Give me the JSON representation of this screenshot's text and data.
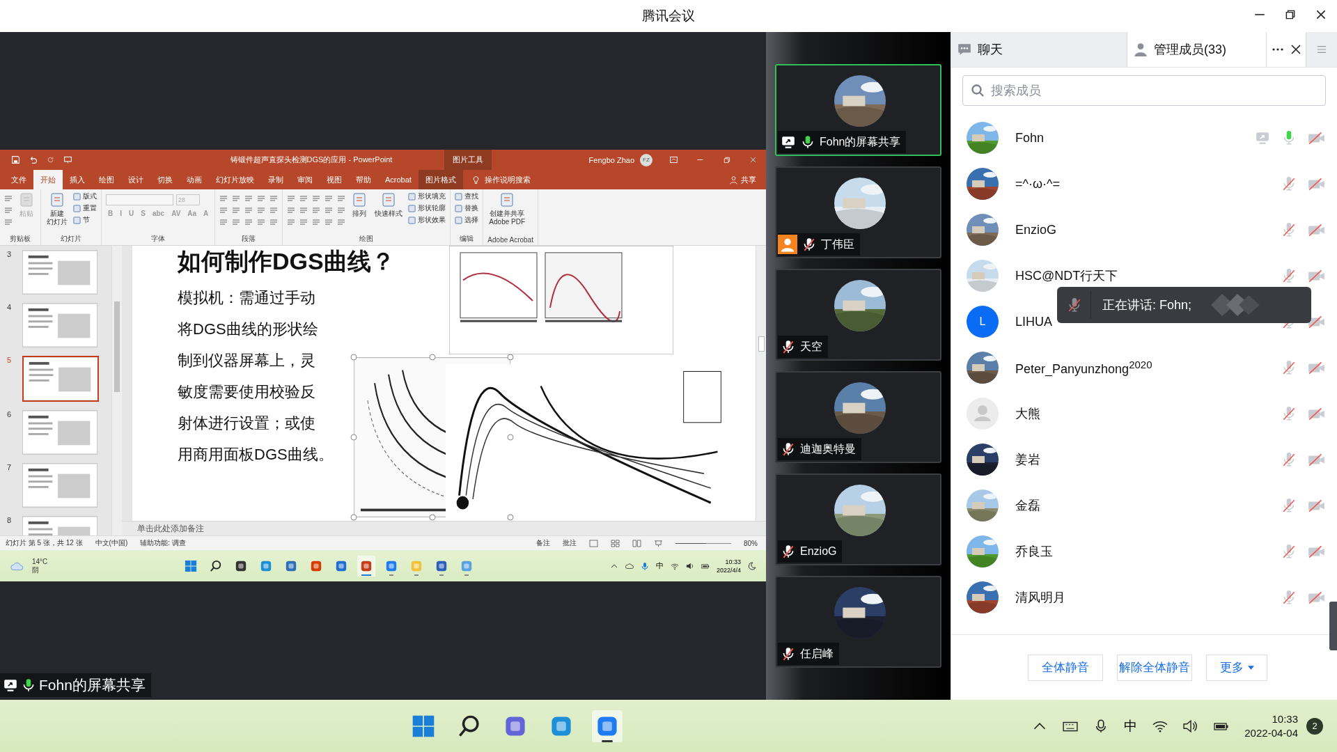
{
  "window": {
    "title": "腾讯会议"
  },
  "share_caption": {
    "text": "Fohn的屏幕共享",
    "mic_on": true
  },
  "ppt": {
    "title": "铸锻件超声直探头检测DGS的应用  -  PowerPoint",
    "context_label": "图片工具",
    "user": "Fengbo Zhao",
    "initials": "FZ",
    "tabs": [
      {
        "label": "文件",
        "selected": false
      },
      {
        "label": "开始",
        "selected": true
      },
      {
        "label": "插入",
        "selected": false
      },
      {
        "label": "绘图",
        "selected": false
      },
      {
        "label": "设计",
        "selected": false
      },
      {
        "label": "切换",
        "selected": false
      },
      {
        "label": "动画",
        "selected": false
      },
      {
        "label": "幻灯片放映",
        "selected": false
      },
      {
        "label": "录制",
        "selected": false
      },
      {
        "label": "审阅",
        "selected": false
      },
      {
        "label": "视图",
        "selected": false
      },
      {
        "label": "帮助",
        "selected": false
      },
      {
        "label": "Acrobat",
        "selected": false
      },
      {
        "label": "图片格式",
        "selected": false,
        "kind": "context"
      }
    ],
    "tell_me": "操作说明搜索",
    "share": "共享",
    "groups": [
      {
        "label": "剪贴板",
        "items": [
          {
            "kind": "large",
            "lines": [
              "粘贴"
            ],
            "disabled": true
          }
        ]
      },
      {
        "label": "幻灯片",
        "items": [
          {
            "kind": "large",
            "lines": [
              "新建",
              "幻灯片"
            ],
            "disabled": false
          },
          {
            "kind": "stack",
            "labels": [
              "版式",
              "重置",
              "节"
            ]
          }
        ]
      },
      {
        "label": "字体",
        "items": [
          {
            "kind": "font",
            "size": "28",
            "glyphs": [
              "B",
              "I",
              "U",
              "S",
              "abc",
              "AV",
              "Aa",
              "A"
            ]
          }
        ]
      },
      {
        "label": "段落"
      },
      {
        "label": "绘图",
        "items": [
          {
            "kind": "large",
            "lines": [
              "排列"
            ],
            "disabled": false
          },
          {
            "kind": "large",
            "lines": [
              "快速样式"
            ],
            "disabled": false
          },
          {
            "kind": "stack",
            "labels": [
              "形状填充",
              "形状轮廓",
              "形状效果"
            ]
          }
        ]
      },
      {
        "label": "编辑",
        "items": [
          {
            "kind": "stack",
            "labels": [
              "查找",
              "替换",
              "选择"
            ]
          }
        ]
      },
      {
        "label": "Adobe Acrobat",
        "items": [
          {
            "kind": "large",
            "lines": [
              "创建并共享",
              "Adobe PDF"
            ],
            "disabled": false
          }
        ]
      }
    ],
    "slides": [
      {
        "number": "3",
        "selected": false
      },
      {
        "number": "4",
        "selected": false
      },
      {
        "number": "5",
        "selected": true
      },
      {
        "number": "6",
        "selected": false
      },
      {
        "number": "7",
        "selected": false
      },
      {
        "number": "8",
        "selected": false
      }
    ],
    "slide": {
      "title": "如何制作DGS曲线？",
      "body_lines": [
        "模拟机：需通过手动",
        "将DGS曲线的形状绘",
        "制到仪器屏幕上，灵",
        "敏度需要使用校验反",
        "射体进行设置；或使",
        "用商用面板DGS曲线。"
      ]
    },
    "notes_placeholder": "单击此处添加备注",
    "status": {
      "slide_info": "幻灯片 第 5 张，共 12 张",
      "language": "中文(中国)",
      "accessibility": "辅助功能: 调查",
      "notes": "备注",
      "comments": "批注",
      "zoom": {
        "level": 0.55
      },
      "zoom_text": "80%"
    },
    "taskbar": {
      "temperature": "14°C",
      "weather": "阴",
      "ime": "中",
      "time": "10:33",
      "date": "2022/4/4",
      "apps": [
        {
          "kind": "start",
          "running": false,
          "selected": false
        },
        {
          "kind": "search",
          "running": false,
          "selected": false
        },
        {
          "kind": "taskview",
          "running": false,
          "selected": false
        },
        {
          "kind": "edge",
          "running": false,
          "selected": false
        },
        {
          "kind": "store",
          "running": false,
          "selected": false
        },
        {
          "kind": "office",
          "running": false,
          "selected": false
        },
        {
          "kind": "tiles",
          "running": false,
          "selected": false
        },
        {
          "kind": "slides",
          "running": true,
          "selected": true
        },
        {
          "kind": "meeting",
          "running": true,
          "selected": false
        },
        {
          "kind": "folder",
          "running": true,
          "selected": false
        },
        {
          "kind": "doc",
          "running": true,
          "selected": false
        },
        {
          "kind": "paint",
          "running": true,
          "selected": false
        }
      ]
    }
  },
  "video_tiles": [
    {
      "name": "Fohn的屏幕共享",
      "sharing": true,
      "host": false,
      "mic_on": true,
      "selected": true
    },
    {
      "name": "丁伟臣",
      "sharing": false,
      "host": true,
      "mic_on": false,
      "selected": false
    },
    {
      "name": "天空",
      "sharing": false,
      "host": false,
      "mic_on": false,
      "selected": false
    },
    {
      "name": "迪迦奥特曼",
      "sharing": false,
      "host": false,
      "mic_on": false,
      "selected": false
    },
    {
      "name": "EnzioG",
      "sharing": false,
      "host": false,
      "mic_on": false,
      "selected": false
    },
    {
      "name": "任启峰",
      "sharing": false,
      "host": false,
      "mic_on": false,
      "selected": false
    }
  ],
  "panel": {
    "tabs": [
      {
        "label": "聊天",
        "selected": false
      },
      {
        "label": "管理成员(33)",
        "selected": true
      }
    ],
    "search_placeholder": "搜索成员",
    "members": [
      {
        "name": "Fohn",
        "sharing": true,
        "mic_on": true
      },
      {
        "name": "=^·ω·^=",
        "sharing": false,
        "mic_on": false
      },
      {
        "name": "EnzioG",
        "sharing": false,
        "mic_on": false
      },
      {
        "name": "HSC@NDT行天下",
        "sharing": false,
        "mic_on": false
      },
      {
        "name": "LIHUA",
        "avatar": {
          "kind": "letter",
          "letter": "L"
        },
        "sharing": false,
        "mic_on": false
      },
      {
        "name": "Peter_Panyunzhong$^{2020}$",
        "sharing": false,
        "mic_on": false
      },
      {
        "name": "大熊",
        "avatar": {
          "kind": "default"
        },
        "sharing": false,
        "mic_on": false
      },
      {
        "name": "姜岩",
        "sharing": false,
        "mic_on": false
      },
      {
        "name": "金磊",
        "sharing": false,
        "mic_on": false
      },
      {
        "name": "乔良玉",
        "sharing": false,
        "mic_on": false
      },
      {
        "name": "清风明月",
        "sharing": false,
        "mic_on": false
      }
    ],
    "speaking_toast": "正在讲话: Fohn;",
    "buttons": [
      "全体静音",
      "解除全体静音"
    ],
    "more": "更多"
  },
  "taskbar": {
    "ime": "中",
    "time": "10:33",
    "date": "2022-04-04",
    "badge": "2",
    "apps": [
      {
        "kind": "start",
        "running": false,
        "selected": false
      },
      {
        "kind": "search",
        "running": false,
        "selected": false
      },
      {
        "kind": "chat",
        "running": false,
        "selected": false
      },
      {
        "kind": "edge",
        "running": false,
        "selected": false
      },
      {
        "kind": "meeting",
        "running": true,
        "selected": true
      }
    ]
  }
}
